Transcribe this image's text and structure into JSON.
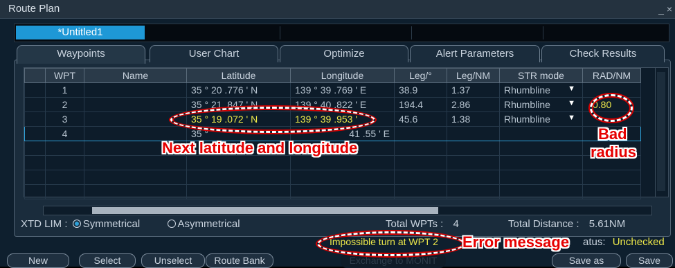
{
  "window": {
    "title": "Route Plan",
    "control": "_ ×"
  },
  "file_tab": "*Untitled1",
  "tabs": [
    "Waypoints",
    "User Chart",
    "Optimize",
    "Alert Parameters",
    "Check Results"
  ],
  "columns": [
    "WPT",
    "Name",
    "Latitude",
    "Longitude",
    "Leg/°",
    "Leg/NM",
    "STR mode",
    "RAD/NM"
  ],
  "rows": [
    {
      "wpt": "1",
      "name": "",
      "lat": "35 ° 20 .776 ' N",
      "lon": "139 ° 39 .769 ' E",
      "leg_deg": "38.9",
      "leg_nm": "1.37",
      "str": "Rhumbline",
      "rad": ""
    },
    {
      "wpt": "2",
      "name": "",
      "lat": "35 ° 21 .847 ' N",
      "lon": "139 ° 40 .822 ' E",
      "leg_deg": "194.4",
      "leg_nm": "2.86",
      "str": "Rhumbline",
      "rad": "0.80"
    },
    {
      "wpt": "3",
      "name": "",
      "lat": "35 ° 19 .072 ' N",
      "lon": "139 ° 39 .953 '",
      "leg_deg": "45.6",
      "leg_nm": "1.38",
      "str": "Rhumbline",
      "rad": ""
    },
    {
      "wpt": "4",
      "name": "",
      "lat": "35 °",
      "lon": "41 .55 ' E",
      "leg_deg": "",
      "leg_nm": "",
      "str": "",
      "rad": ""
    }
  ],
  "xtd": {
    "label": "XTD LIM :",
    "opt1": "Symmetrical",
    "opt2": "Asymmetrical"
  },
  "totals": {
    "wpts_label": "Total WPTs :",
    "wpts_value": "4",
    "dist_label": "Total Distance :",
    "dist_value": "5.61NM"
  },
  "message": "Impossible turn at WPT 2",
  "status": {
    "label": "atus:",
    "value": "Unchecked"
  },
  "buttons": {
    "new": "New",
    "select": "Select",
    "unselect": "Unselect",
    "route_bank": "Route Bank",
    "exchange": "Exchange to MONIT",
    "save_as": "Save as",
    "save": "Save"
  },
  "annotations": {
    "latlon": "Next latitude and longitude",
    "bad": "Bad",
    "radius": "radius",
    "error": "Error message"
  },
  "colors": {
    "accent": "#1e98d6",
    "highlight": "#ede84a",
    "annotation": "#e60000"
  }
}
